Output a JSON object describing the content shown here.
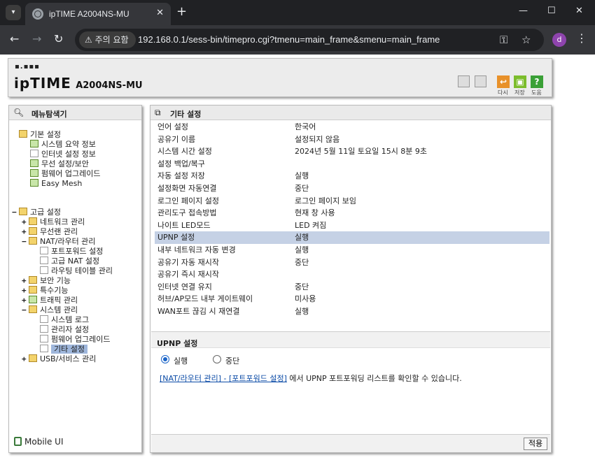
{
  "browser": {
    "tab_title": "ipTIME A2004NS-MU",
    "security_warning": "주의 요함",
    "url": "192.168.0.1/sess-bin/timepro.cgi?tmenu=main_frame&smenu=main_frame",
    "profile_initial": "d"
  },
  "header": {
    "logo_dots": "▪.▪▪▪",
    "logo_text": "ipTIME",
    "model": "A2004NS-MU",
    "buttons": [
      {
        "label": "다시",
        "color": "#e8912a"
      },
      {
        "label": "저장",
        "color": "#7cbd2c"
      },
      {
        "label": "도움",
        "color": "#3aa036"
      }
    ]
  },
  "sidebar": {
    "title": "메뉴탐색기",
    "basic": {
      "label": "기본 설정",
      "items": [
        "시스템 요약 정보",
        "인터넷 설정 정보",
        "무선 설정/보안",
        "펌웨어 업그레이드",
        "Easy Mesh"
      ]
    },
    "advanced": {
      "label": "고급 설정",
      "network": "네트워크 관리",
      "wireless": "무선랜 관리",
      "nat": "NAT/라우터 관리",
      "nat_items": [
        "포트포워드 설정",
        "고급 NAT 설정",
        "라우팅 테이블 관리"
      ],
      "security": "보안 기능",
      "special": "특수기능",
      "traffic": "트래픽 관리",
      "system": "시스템 관리",
      "system_items": [
        "시스템 로그",
        "관리자 설정",
        "펌웨어 업그레이드",
        "기타 설정"
      ],
      "usb": "USB/서비스 관리"
    },
    "mobile": "Mobile UI"
  },
  "panel": {
    "title": "기타 설정",
    "rows": [
      {
        "key": "언어 설정",
        "value": "한국어"
      },
      {
        "key": "공유기 이름",
        "value": "설정되지 않음"
      },
      {
        "key": "시스템 시간 설정",
        "value": "2024년 5월 11일 토요일 15시 8분 9초"
      },
      {
        "key": "설정 백업/복구",
        "value": ""
      },
      {
        "key": "자동 설정 저장",
        "value": "실행"
      },
      {
        "key": "설정화면 자동연결",
        "value": "중단"
      },
      {
        "key": "로그인 페이지 설정",
        "value": "로그인 페이지 보임"
      },
      {
        "key": "관리도구 접속방법",
        "value": "현재 창 사용"
      },
      {
        "key": "나이트 LED모드",
        "value": "LED 켜짐"
      },
      {
        "key": "UPNP 설정",
        "value": "실행"
      },
      {
        "key": "내부 네트워크 자동 변경",
        "value": "실행"
      },
      {
        "key": "공유기 자동 재시작",
        "value": "중단"
      },
      {
        "key": "공유기 즉시 재시작",
        "value": ""
      },
      {
        "key": "인터넷 연결 유지",
        "value": "중단"
      },
      {
        "key": "허브/AP모드 내부 게이트웨이",
        "value": "미사용"
      },
      {
        "key": "WAN포트 끊김 시 재연결",
        "value": "실행"
      }
    ],
    "upnp": {
      "title": "UPNP 설정",
      "option_on": "실행",
      "option_off": "중단",
      "selected": "실행",
      "link": "[NAT/라우터 관리] - [포트포워드 설정]",
      "info": " 에서 UPNP 포트포워딩 리스트를 확인할 수 있습니다."
    },
    "apply_label": "적용"
  }
}
